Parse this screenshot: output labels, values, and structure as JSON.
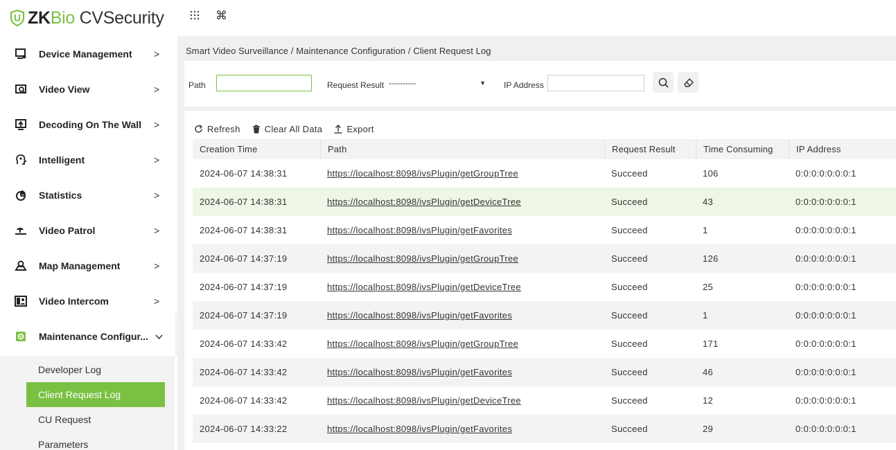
{
  "app": {
    "brand_zk": "ZK",
    "brand_bio": "Bio",
    "brand_product": " CVSecurity"
  },
  "colors": {
    "accent": "#7ac143",
    "row_alt": "#f3f3f3",
    "row_highlight": "#eef6e6"
  },
  "header_icons": [
    "apps-grid-icon",
    "command-icon"
  ],
  "sidebar": {
    "items": [
      {
        "label": "Device Management",
        "icon": "device-icon"
      },
      {
        "label": "Video View",
        "icon": "video-view-icon"
      },
      {
        "label": "Decoding On The Wall",
        "icon": "decoding-icon"
      },
      {
        "label": "Intelligent",
        "icon": "intelligent-icon"
      },
      {
        "label": "Statistics",
        "icon": "pie-chart-icon"
      },
      {
        "label": "Video Patrol",
        "icon": "patrol-icon"
      },
      {
        "label": "Map Management",
        "icon": "map-icon"
      },
      {
        "label": "Video Intercom",
        "icon": "intercom-icon"
      },
      {
        "label": "Maintenance Configur...",
        "icon": "maintenance-icon"
      }
    ],
    "submenu": [
      {
        "label": "Developer Log"
      },
      {
        "label": "Client Request Log",
        "active": true
      },
      {
        "label": "CU Request"
      },
      {
        "label": "Parameters"
      }
    ],
    "collapse": "«"
  },
  "breadcrumb": "Smart Video Surveillance / Maintenance Configuration / Client Request Log",
  "filters": {
    "path_label": "Path",
    "path_value": "",
    "result_label": "Request Result",
    "result_value": "----------",
    "ip_label": "IP Address",
    "ip_value": ""
  },
  "toolbar": {
    "refresh": "Refresh",
    "clear": "Clear All Data",
    "export": "Export"
  },
  "table": {
    "columns": [
      "Creation Time",
      "Path",
      "Request Result",
      "Time Consuming",
      "IP Address"
    ],
    "rows": [
      [
        "2024-06-07 14:38:31",
        "https://localhost:8098/ivsPlugin/getGroupTree",
        "Succeed",
        "106",
        "0:0:0:0:0:0:0:1"
      ],
      [
        "2024-06-07 14:38:31",
        "https://localhost:8098/ivsPlugin/getDeviceTree",
        "Succeed",
        "43",
        "0:0:0:0:0:0:0:1"
      ],
      [
        "2024-06-07 14:38:31",
        "https://localhost:8098/ivsPlugin/getFavorites",
        "Succeed",
        "1",
        "0:0:0:0:0:0:0:1"
      ],
      [
        "2024-06-07 14:37:19",
        "https://localhost:8098/ivsPlugin/getGroupTree",
        "Succeed",
        "126",
        "0:0:0:0:0:0:0:1"
      ],
      [
        "2024-06-07 14:37:19",
        "https://localhost:8098/ivsPlugin/getDeviceTree",
        "Succeed",
        "25",
        "0:0:0:0:0:0:0:1"
      ],
      [
        "2024-06-07 14:37:19",
        "https://localhost:8098/ivsPlugin/getFavorites",
        "Succeed",
        "1",
        "0:0:0:0:0:0:0:1"
      ],
      [
        "2024-06-07 14:33:42",
        "https://localhost:8098/ivsPlugin/getGroupTree",
        "Succeed",
        "171",
        "0:0:0:0:0:0:0:1"
      ],
      [
        "2024-06-07 14:33:42",
        "https://localhost:8098/ivsPlugin/getFavorites",
        "Succeed",
        "46",
        "0:0:0:0:0:0:0:1"
      ],
      [
        "2024-06-07 14:33:42",
        "https://localhost:8098/ivsPlugin/getDeviceTree",
        "Succeed",
        "12",
        "0:0:0:0:0:0:0:1"
      ],
      [
        "2024-06-07 14:33:22",
        "https://localhost:8098/ivsPlugin/getFavorites",
        "Succeed",
        "29",
        "0:0:0:0:0:0:0:1"
      ]
    ]
  }
}
